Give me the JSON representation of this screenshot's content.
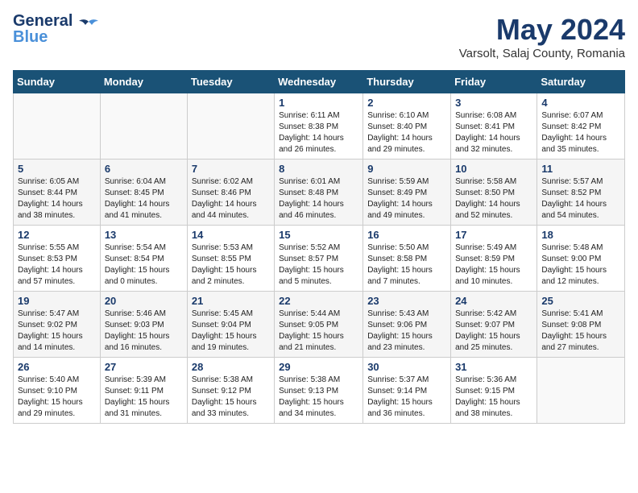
{
  "header": {
    "logo_general": "General",
    "logo_blue": "Blue",
    "month": "May 2024",
    "location": "Varsolt, Salaj County, Romania"
  },
  "days_of_week": [
    "Sunday",
    "Monday",
    "Tuesday",
    "Wednesday",
    "Thursday",
    "Friday",
    "Saturday"
  ],
  "weeks": [
    [
      {
        "day": "",
        "content": ""
      },
      {
        "day": "",
        "content": ""
      },
      {
        "day": "",
        "content": ""
      },
      {
        "day": "1",
        "content": "Sunrise: 6:11 AM\nSunset: 8:38 PM\nDaylight: 14 hours\nand 26 minutes."
      },
      {
        "day": "2",
        "content": "Sunrise: 6:10 AM\nSunset: 8:40 PM\nDaylight: 14 hours\nand 29 minutes."
      },
      {
        "day": "3",
        "content": "Sunrise: 6:08 AM\nSunset: 8:41 PM\nDaylight: 14 hours\nand 32 minutes."
      },
      {
        "day": "4",
        "content": "Sunrise: 6:07 AM\nSunset: 8:42 PM\nDaylight: 14 hours\nand 35 minutes."
      }
    ],
    [
      {
        "day": "5",
        "content": "Sunrise: 6:05 AM\nSunset: 8:44 PM\nDaylight: 14 hours\nand 38 minutes."
      },
      {
        "day": "6",
        "content": "Sunrise: 6:04 AM\nSunset: 8:45 PM\nDaylight: 14 hours\nand 41 minutes."
      },
      {
        "day": "7",
        "content": "Sunrise: 6:02 AM\nSunset: 8:46 PM\nDaylight: 14 hours\nand 44 minutes."
      },
      {
        "day": "8",
        "content": "Sunrise: 6:01 AM\nSunset: 8:48 PM\nDaylight: 14 hours\nand 46 minutes."
      },
      {
        "day": "9",
        "content": "Sunrise: 5:59 AM\nSunset: 8:49 PM\nDaylight: 14 hours\nand 49 minutes."
      },
      {
        "day": "10",
        "content": "Sunrise: 5:58 AM\nSunset: 8:50 PM\nDaylight: 14 hours\nand 52 minutes."
      },
      {
        "day": "11",
        "content": "Sunrise: 5:57 AM\nSunset: 8:52 PM\nDaylight: 14 hours\nand 54 minutes."
      }
    ],
    [
      {
        "day": "12",
        "content": "Sunrise: 5:55 AM\nSunset: 8:53 PM\nDaylight: 14 hours\nand 57 minutes."
      },
      {
        "day": "13",
        "content": "Sunrise: 5:54 AM\nSunset: 8:54 PM\nDaylight: 15 hours\nand 0 minutes."
      },
      {
        "day": "14",
        "content": "Sunrise: 5:53 AM\nSunset: 8:55 PM\nDaylight: 15 hours\nand 2 minutes."
      },
      {
        "day": "15",
        "content": "Sunrise: 5:52 AM\nSunset: 8:57 PM\nDaylight: 15 hours\nand 5 minutes."
      },
      {
        "day": "16",
        "content": "Sunrise: 5:50 AM\nSunset: 8:58 PM\nDaylight: 15 hours\nand 7 minutes."
      },
      {
        "day": "17",
        "content": "Sunrise: 5:49 AM\nSunset: 8:59 PM\nDaylight: 15 hours\nand 10 minutes."
      },
      {
        "day": "18",
        "content": "Sunrise: 5:48 AM\nSunset: 9:00 PM\nDaylight: 15 hours\nand 12 minutes."
      }
    ],
    [
      {
        "day": "19",
        "content": "Sunrise: 5:47 AM\nSunset: 9:02 PM\nDaylight: 15 hours\nand 14 minutes."
      },
      {
        "day": "20",
        "content": "Sunrise: 5:46 AM\nSunset: 9:03 PM\nDaylight: 15 hours\nand 16 minutes."
      },
      {
        "day": "21",
        "content": "Sunrise: 5:45 AM\nSunset: 9:04 PM\nDaylight: 15 hours\nand 19 minutes."
      },
      {
        "day": "22",
        "content": "Sunrise: 5:44 AM\nSunset: 9:05 PM\nDaylight: 15 hours\nand 21 minutes."
      },
      {
        "day": "23",
        "content": "Sunrise: 5:43 AM\nSunset: 9:06 PM\nDaylight: 15 hours\nand 23 minutes."
      },
      {
        "day": "24",
        "content": "Sunrise: 5:42 AM\nSunset: 9:07 PM\nDaylight: 15 hours\nand 25 minutes."
      },
      {
        "day": "25",
        "content": "Sunrise: 5:41 AM\nSunset: 9:08 PM\nDaylight: 15 hours\nand 27 minutes."
      }
    ],
    [
      {
        "day": "26",
        "content": "Sunrise: 5:40 AM\nSunset: 9:10 PM\nDaylight: 15 hours\nand 29 minutes."
      },
      {
        "day": "27",
        "content": "Sunrise: 5:39 AM\nSunset: 9:11 PM\nDaylight: 15 hours\nand 31 minutes."
      },
      {
        "day": "28",
        "content": "Sunrise: 5:38 AM\nSunset: 9:12 PM\nDaylight: 15 hours\nand 33 minutes."
      },
      {
        "day": "29",
        "content": "Sunrise: 5:38 AM\nSunset: 9:13 PM\nDaylight: 15 hours\nand 34 minutes."
      },
      {
        "day": "30",
        "content": "Sunrise: 5:37 AM\nSunset: 9:14 PM\nDaylight: 15 hours\nand 36 minutes."
      },
      {
        "day": "31",
        "content": "Sunrise: 5:36 AM\nSunset: 9:15 PM\nDaylight: 15 hours\nand 38 minutes."
      },
      {
        "day": "",
        "content": ""
      }
    ]
  ]
}
